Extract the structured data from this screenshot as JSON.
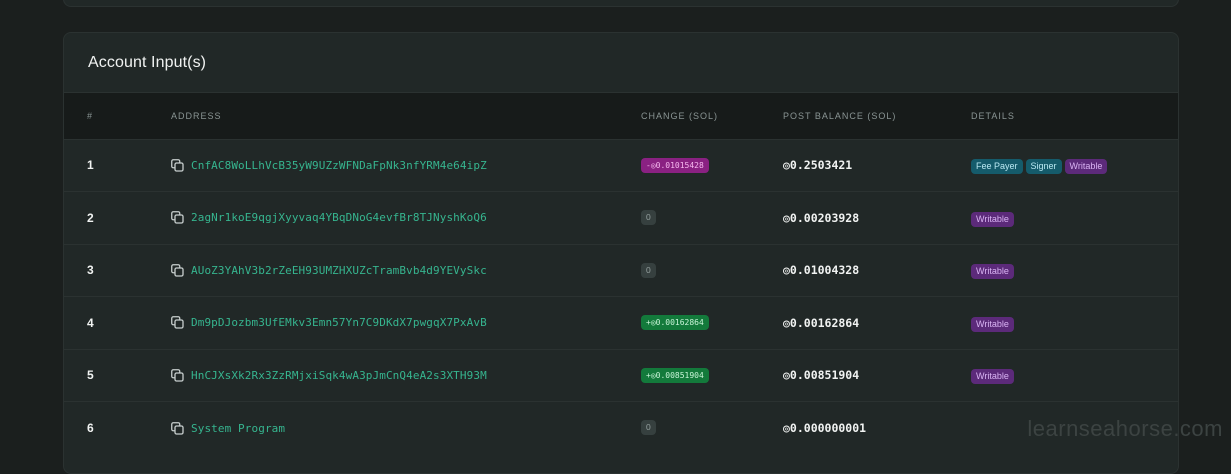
{
  "card": {
    "title": "Account Input(s)"
  },
  "columns": [
    "#",
    "ADDRESS",
    "CHANGE (SOL)",
    "POST BALANCE (SOL)",
    "DETAILS"
  ],
  "rows": [
    {
      "num": "1",
      "address": "CnfAC8WoLLhVcB35yW9UZzWFNDaFpNk3nfYRM4e64ipZ",
      "change": "-◎0.01015428",
      "change_type": "negative",
      "balance": "◎0.2503421",
      "tags": [
        {
          "label": "Fee Payer",
          "color": "teal"
        },
        {
          "label": "Signer",
          "color": "teal"
        },
        {
          "label": "Writable",
          "color": "purple"
        }
      ]
    },
    {
      "num": "2",
      "address": "2agNr1koE9qgjXyyvaq4YBqDNoG4evfBr8TJNyshKoQ6",
      "change": "0",
      "change_type": "zero",
      "balance": "◎0.00203928",
      "tags": [
        {
          "label": "Writable",
          "color": "purple"
        }
      ]
    },
    {
      "num": "3",
      "address": "AUoZ3YAhV3b2rZeEH93UMZHXUZcTramBvb4d9YEVySkc",
      "change": "0",
      "change_type": "zero",
      "balance": "◎0.01004328",
      "tags": [
        {
          "label": "Writable",
          "color": "purple"
        }
      ]
    },
    {
      "num": "4",
      "address": "Dm9pDJozbm3UfEMkv3Emn57Yn7C9DKdX7pwgqX7PxAvB",
      "change": "+◎0.00162864",
      "change_type": "positive",
      "balance": "◎0.00162864",
      "tags": [
        {
          "label": "Writable",
          "color": "purple"
        }
      ]
    },
    {
      "num": "5",
      "address": "HnCJXsXk2Rx3ZzRMjxiSqk4wA3pJmCnQ4eA2s3XTH93M",
      "change": "+◎0.00851904",
      "change_type": "positive",
      "balance": "◎0.00851904",
      "tags": [
        {
          "label": "Writable",
          "color": "purple"
        }
      ]
    },
    {
      "num": "6",
      "address": "System Program",
      "change": "0",
      "change_type": "zero",
      "balance": "◎0.000000001",
      "tags": []
    }
  ],
  "watermark": "learnseahorse.com",
  "icons": {
    "copy": "copy-icon"
  },
  "colors": {
    "address": "#36b58f",
    "negative_badge": "#8a2182",
    "positive_badge": "#137a3b",
    "tag_teal": "#155b6b",
    "tag_purple": "#5c2a7a"
  }
}
